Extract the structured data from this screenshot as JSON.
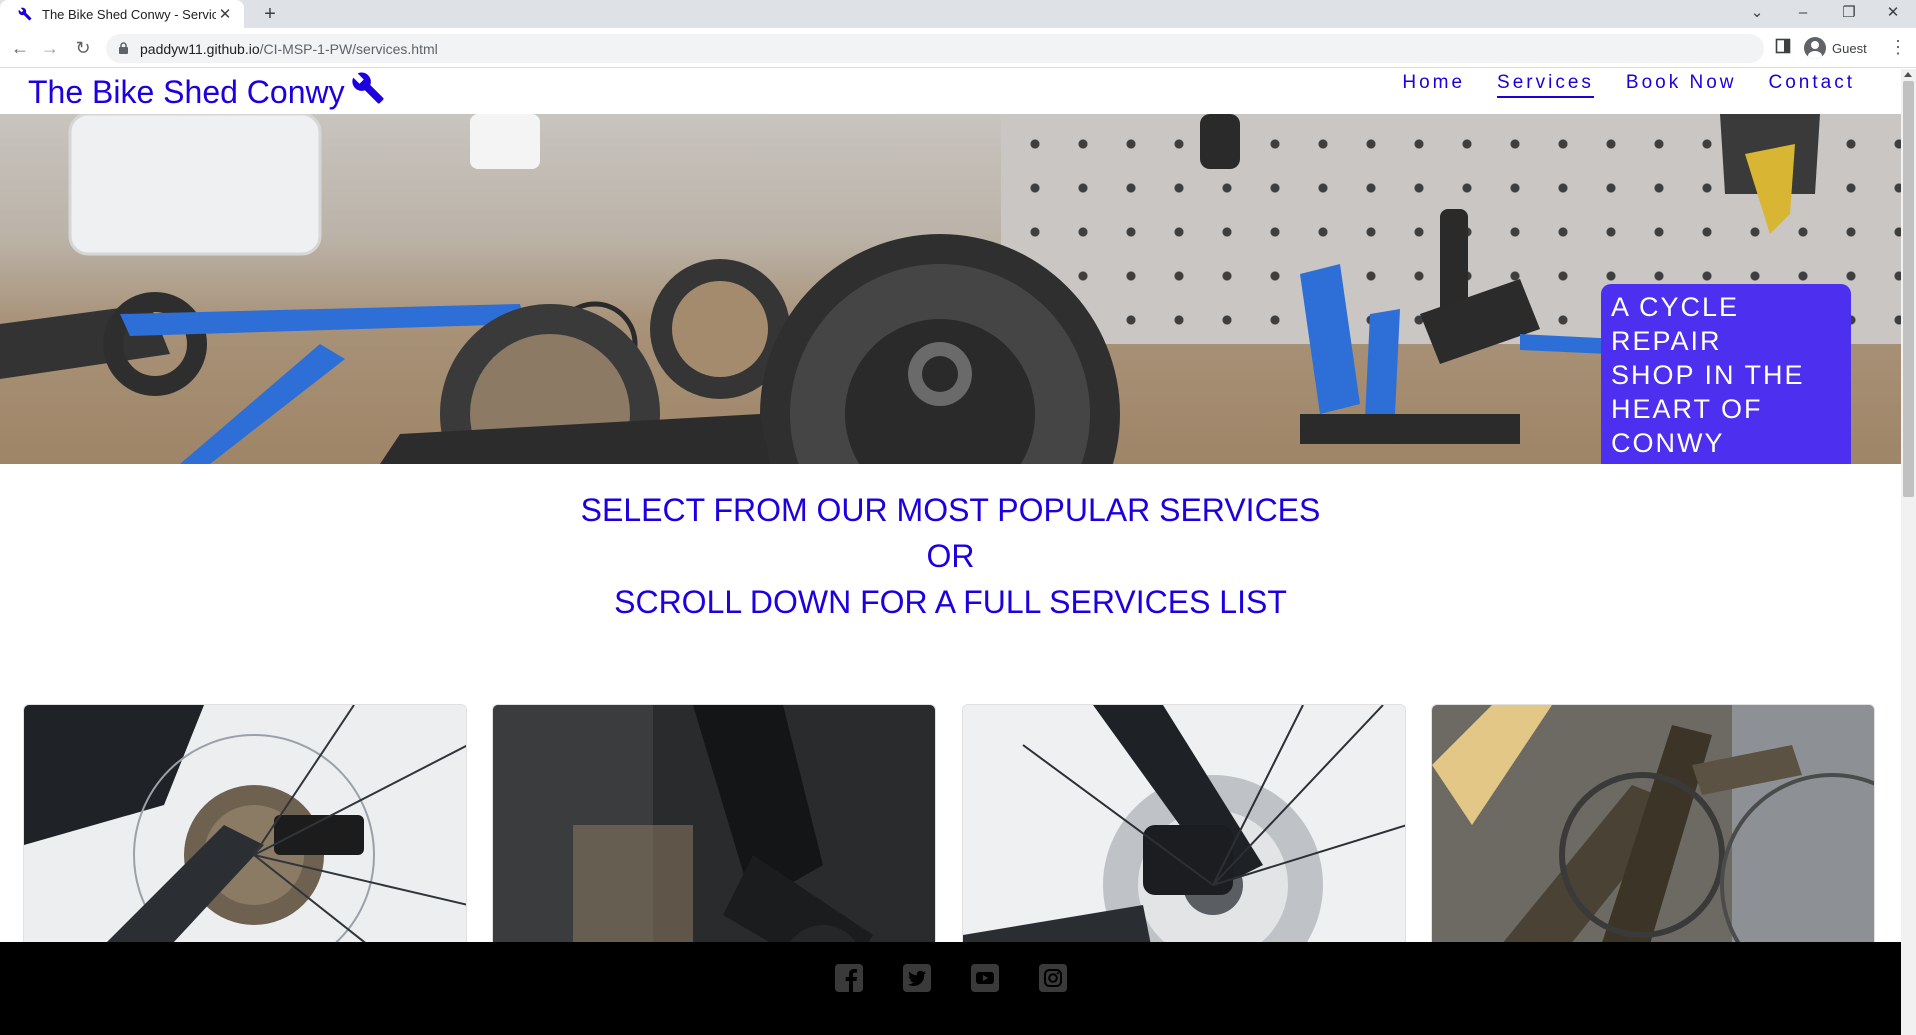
{
  "browser": {
    "tab_title": "The Bike Shed Conwy - Services",
    "url_host": "paddyw11.github.io",
    "url_path": "/CI-MSP-1-PW/services.html",
    "profile_label": "Guest"
  },
  "site": {
    "logo_text": "The Bike Shed Conwy",
    "nav": {
      "home": "Home",
      "services": "Services",
      "book": "Book Now",
      "contact": "Contact"
    },
    "hero_caption": {
      "line1": "A CYCLE REPAIR",
      "line2": "SHOP IN THE",
      "line3": "HEART OF",
      "line4": "CONWY"
    },
    "intro": {
      "line1": "SELECT FROM OUR MOST POPULAR SERVICES",
      "line2": "OR",
      "line3": "SCROLL DOWN FOR A FULL SERVICES LIST"
    },
    "social_icons": [
      "facebook-icon",
      "twitter-icon",
      "youtube-icon",
      "instagram-icon"
    ]
  },
  "colors": {
    "brand": "#1c00e0",
    "caption_bg": "#4d2ff0",
    "footer_bg": "#000000"
  }
}
